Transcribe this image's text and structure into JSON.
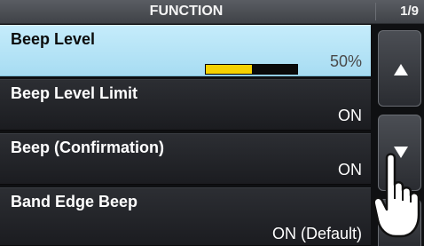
{
  "header": {
    "title": "FUNCTION",
    "page": "1/9"
  },
  "menu": {
    "items": [
      {
        "label": "Beep Level",
        "value": "50%",
        "level": 0.5
      },
      {
        "label": "Beep Level Limit",
        "value": "ON"
      },
      {
        "label": "Beep (Confirmation)",
        "value": "ON"
      },
      {
        "label": "Band Edge Beep",
        "value": "ON (Default)"
      }
    ]
  },
  "side_buttons": {
    "up_icon": "triangle-up-icon",
    "down_icon": "triangle-down-icon",
    "back_icon": "return-arrow-icon"
  },
  "colors": {
    "selected_row": "#a7dcf2",
    "level_fill": "#f5d000",
    "background": "#0f1012"
  }
}
